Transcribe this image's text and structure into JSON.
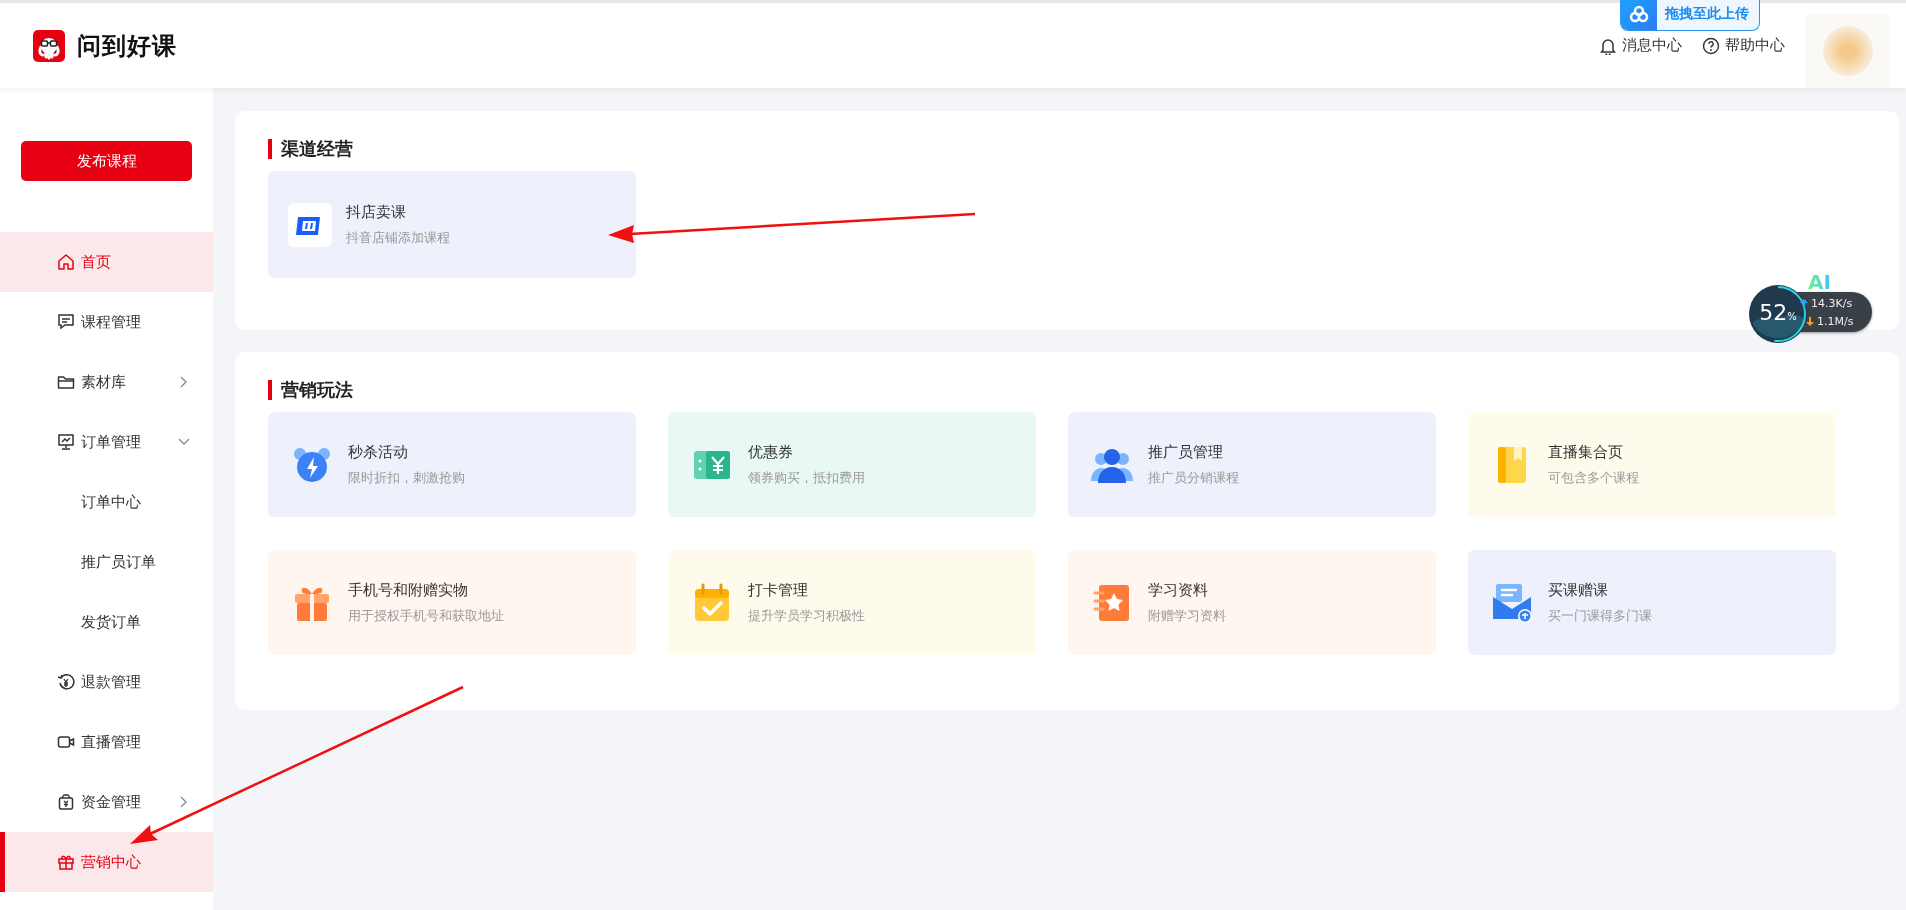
{
  "header": {
    "logo_text": "问到好课",
    "upload_badge": "拖拽至此上传",
    "links": [
      {
        "kind": "bell",
        "label": "消息中心"
      },
      {
        "kind": "help",
        "label": "帮助中心"
      }
    ]
  },
  "sidebar": {
    "publish_button": "发布课程",
    "items": [
      {
        "kind": "home",
        "label": "首页",
        "selected": true,
        "current": false
      },
      {
        "kind": "chat",
        "label": "课程管理",
        "selected": false,
        "current": false
      },
      {
        "kind": "folder",
        "label": "素材库",
        "selected": false,
        "current": false,
        "expanded": false
      },
      {
        "kind": "monitor",
        "label": "订单管理",
        "selected": false,
        "current": false,
        "expanded": true,
        "children": [
          {
            "label": "订单中心",
            "selected": false
          },
          {
            "label": "推广员订单",
            "selected": false
          },
          {
            "label": "发货订单",
            "selected": false
          }
        ]
      },
      {
        "kind": "refund",
        "label": "退款管理",
        "selected": false,
        "current": false
      },
      {
        "kind": "video",
        "label": "直播管理",
        "selected": false,
        "current": false
      },
      {
        "kind": "wallet",
        "label": "资金管理",
        "selected": false,
        "current": false,
        "expanded": false
      },
      {
        "kind": "gift",
        "label": "营销中心",
        "selected": true,
        "current": true
      }
    ]
  },
  "sections": [
    {
      "title": "渠道经营",
      "tiles": [
        {
          "kind": "douyin",
          "title": "抖店卖课",
          "subtitle": "抖音店铺添加课程",
          "color": "#eef0fb"
        }
      ]
    },
    {
      "title": "营销玩法",
      "tiles": [
        {
          "kind": "alarm",
          "title": "秒杀活动",
          "subtitle": "限时折扣，刺激抢购",
          "color": "#eef0fb"
        },
        {
          "kind": "coupon",
          "title": "优惠券",
          "subtitle": "领券购买，抵扣费用",
          "color": "#e9f8f4"
        },
        {
          "kind": "people",
          "title": "推广员管理",
          "subtitle": "推广员分销课程",
          "color": "#eef0fb"
        },
        {
          "kind": "bookmark",
          "title": "直播集合页",
          "subtitle": "可包含多个课程",
          "color": "#fffbec"
        },
        {
          "kind": "gift",
          "title": "手机号和附赠实物",
          "subtitle": "用于授权手机号和获取地址",
          "color": "#fff6f0"
        },
        {
          "kind": "calendar",
          "title": "打卡管理",
          "subtitle": "提升学员学习积极性",
          "color": "#fffbec"
        },
        {
          "kind": "star",
          "title": "学习资料",
          "subtitle": "附赠学习资料",
          "color": "#fff6f0"
        },
        {
          "kind": "mail",
          "title": "买课赠课",
          "subtitle": "买一门课得多门课",
          "color": "#eef0fb"
        }
      ]
    }
  ],
  "speed_widget": {
    "badge": "AI",
    "percent": "52",
    "percent_unit": "%",
    "level": 0.52,
    "upload": "14.3K/s",
    "download": "1.1M/s"
  }
}
